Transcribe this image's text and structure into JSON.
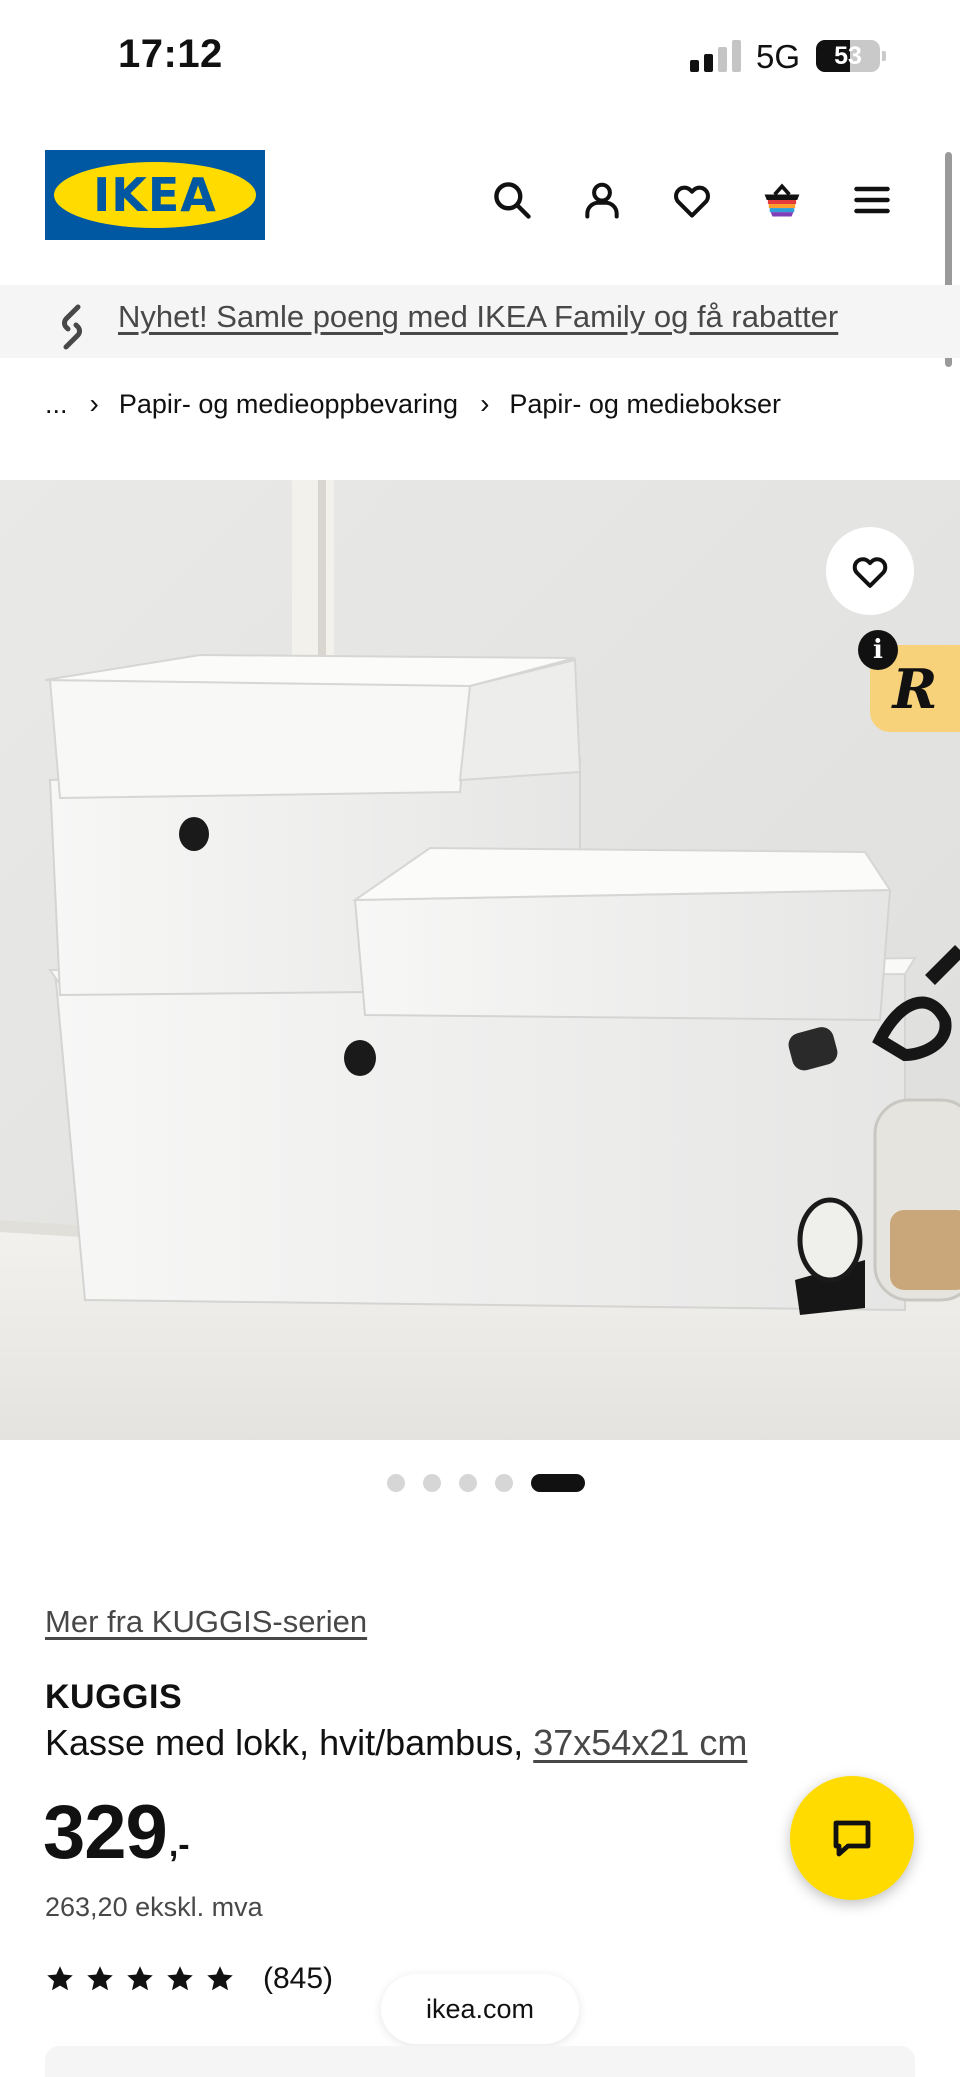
{
  "status_bar": {
    "time": "17:12",
    "network": "5G",
    "battery": "53"
  },
  "header": {
    "logo_text": "IKEA",
    "icons": [
      "search-icon",
      "account-icon",
      "heart-icon",
      "basket-icon",
      "menu-icon"
    ]
  },
  "banner": {
    "icon": "family-link-icon",
    "text": "Nyhet! Samle poeng med IKEA Family og få rabatter"
  },
  "breadcrumb": {
    "ellipsis": "...",
    "items": [
      "Papir- og medieoppbevaring",
      "Papir- og mediebokser"
    ]
  },
  "gallery": {
    "total_images": 5,
    "active_index": 4,
    "badge_info": "i",
    "badge_logo": "R"
  },
  "product": {
    "series_link": "Mer fra KUGGIS-serien",
    "name": "KUGGIS",
    "description": "Kasse med lokk, hvit/bambus,",
    "size_link": "37x54x21 cm",
    "price": "329",
    "price_suffix": ",-",
    "price_ex_vat": "263,20 ekskl. mva",
    "rating": 5,
    "rating_count": "(845)"
  },
  "browser": {
    "url": "ikea.com"
  },
  "colors": {
    "ikea_blue": "#0058a3",
    "ikea_yellow": "#ffdb00",
    "banner_bg": "#f5f5f5",
    "badge_bg": "#f7d27a"
  }
}
